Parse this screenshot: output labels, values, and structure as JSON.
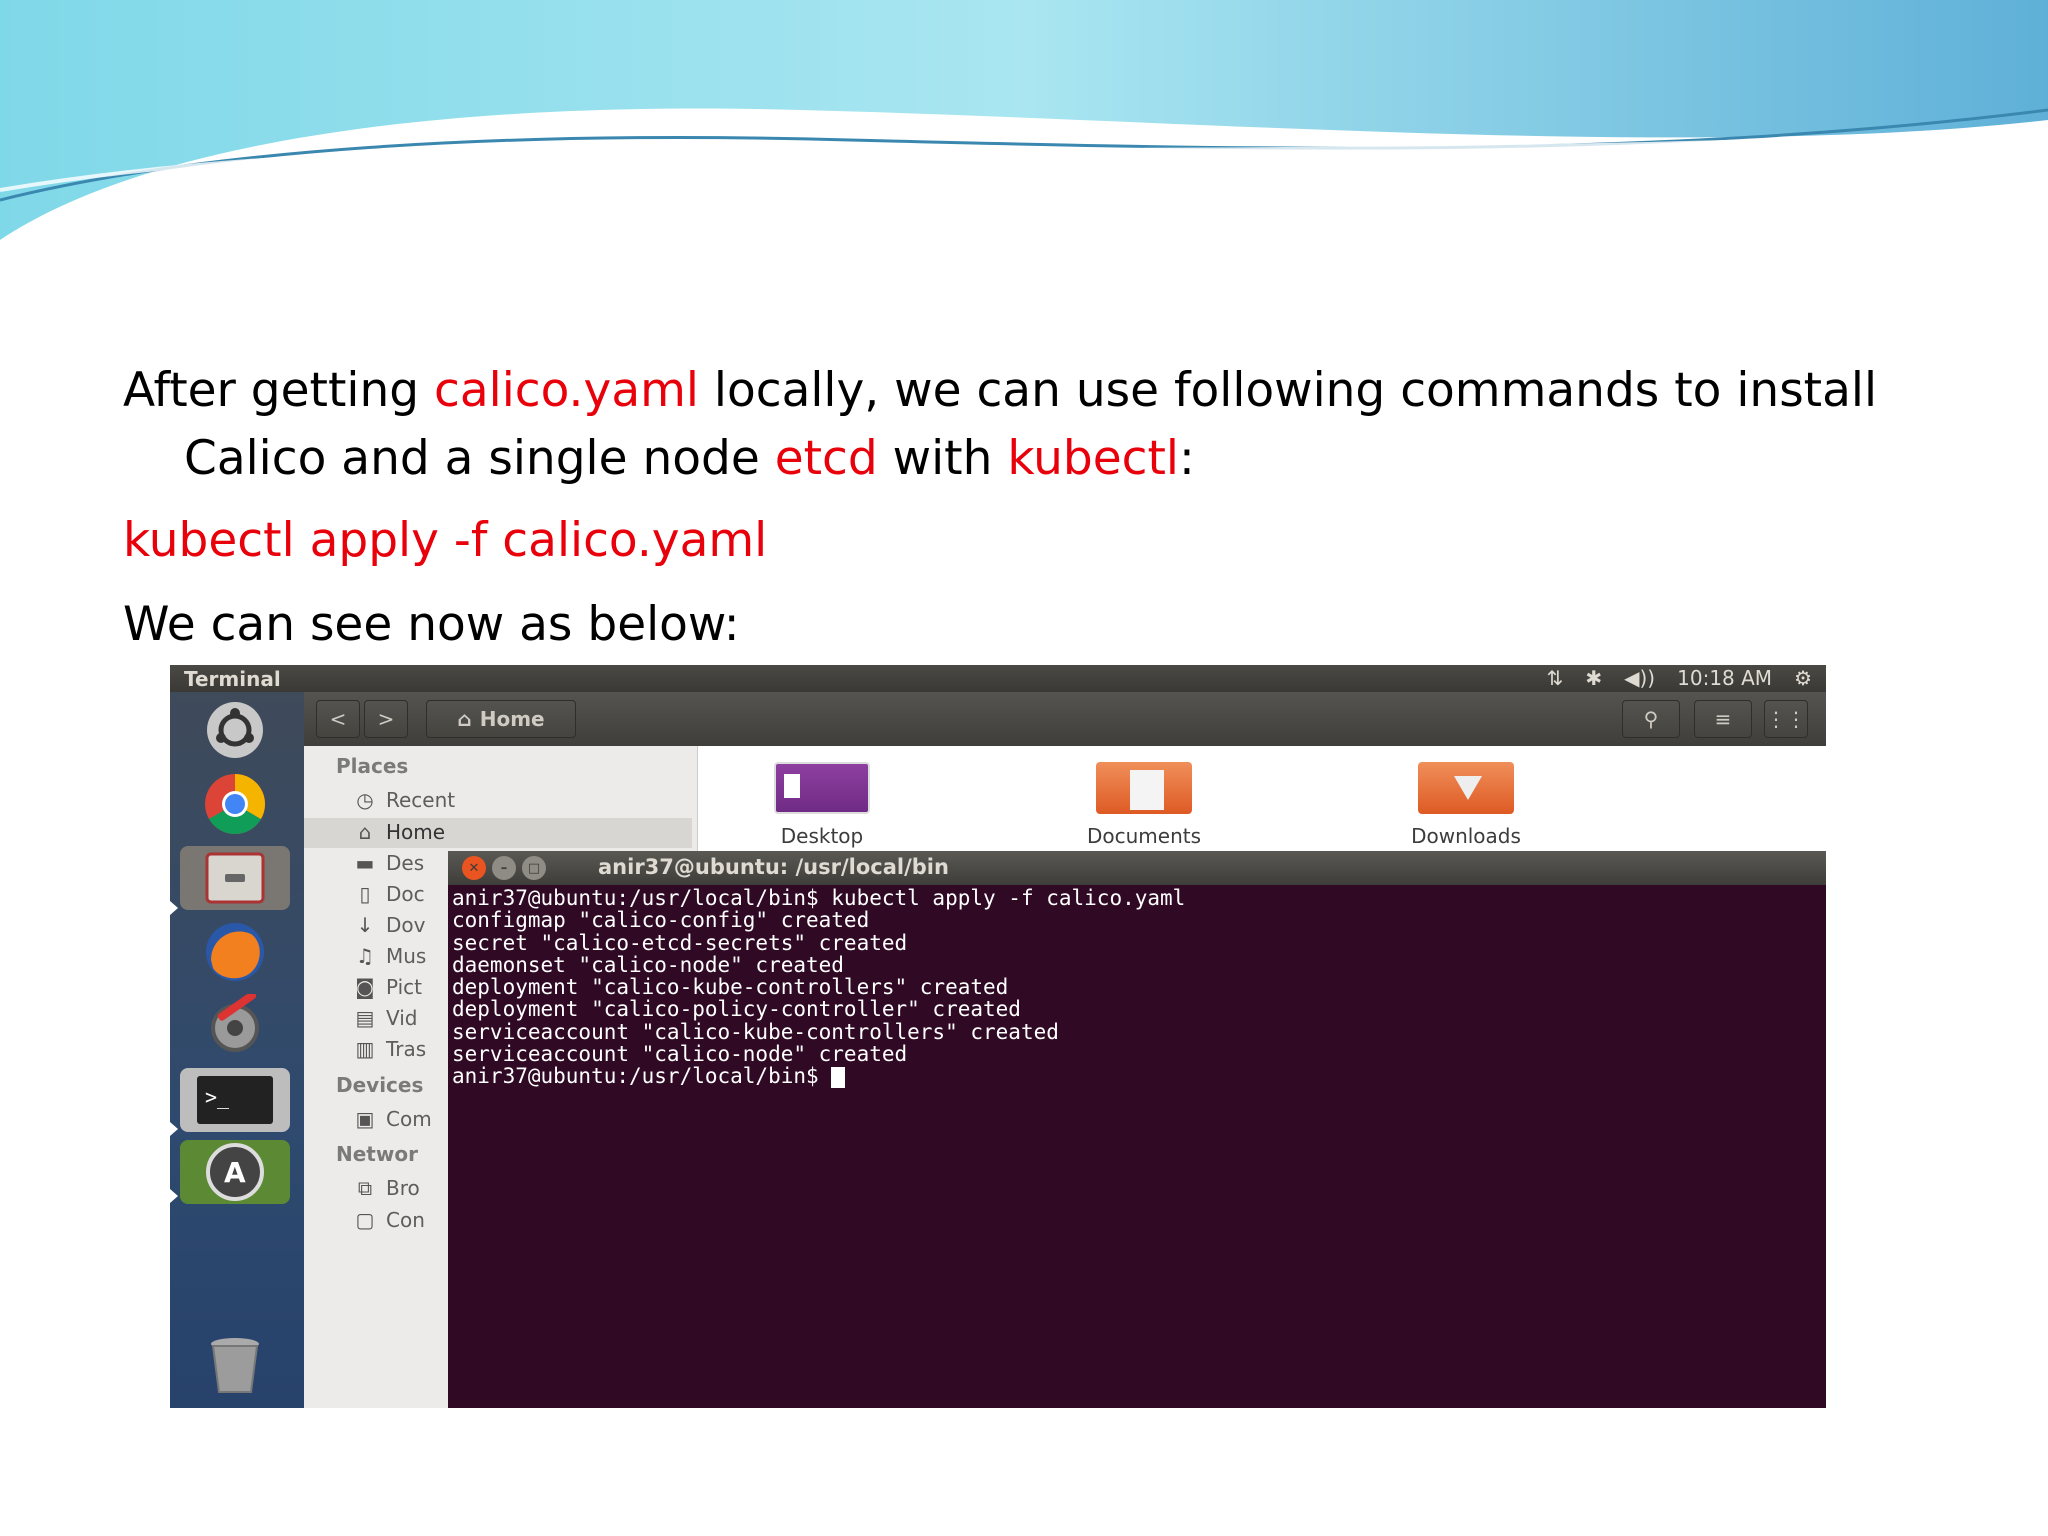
{
  "slide": {
    "para1": {
      "t1": "After getting ",
      "t2": "calico.yaml",
      "t3": " locally, we can use following commands to install",
      "t4": "Calico and a single node ",
      "t5": "etcd",
      "t6": " with ",
      "t7": "kubectl",
      "t8": ":"
    },
    "command": "kubectl apply -f calico.yaml",
    "para2": "We can see now as below:",
    "accent_color": "#e8000b"
  },
  "top_panel": {
    "title": "Terminal",
    "time": "10:18 AM",
    "icons": [
      "network-icon",
      "bluetooth-icon",
      "volume-icon",
      "gear-icon"
    ]
  },
  "nautilus": {
    "path_label": "Home",
    "sidebar": {
      "places_heading": "Places",
      "items": [
        "Recent",
        "Home",
        "Des",
        "Doc",
        "Dov",
        "Mus",
        "Pict",
        "Vid",
        "Tras"
      ],
      "devices_heading": "Devices",
      "device_items": [
        "Com"
      ],
      "network_heading": "Networ",
      "network_items": [
        "Bro",
        "Con"
      ]
    },
    "folders": [
      "Desktop",
      "Documents",
      "Downloads"
    ]
  },
  "terminal": {
    "title": "anir37@ubuntu: /usr/local/bin",
    "lines": [
      "anir37@ubuntu:/usr/local/bin$ kubectl apply -f calico.yaml",
      "configmap \"calico-config\" created",
      "secret \"calico-etcd-secrets\" created",
      "daemonset \"calico-node\" created",
      "deployment \"calico-kube-controllers\" created",
      "deployment \"calico-policy-controller\" created",
      "serviceaccount \"calico-kube-controllers\" created",
      "serviceaccount \"calico-node\" created"
    ],
    "prompt": "anir37@ubuntu:/usr/local/bin$ ",
    "background": "#300a24"
  }
}
